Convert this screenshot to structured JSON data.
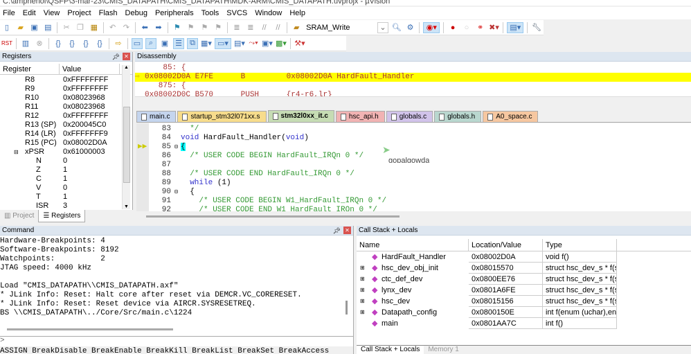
{
  "window": {
    "title": "C:\\amphenol\\QSFP\\3-mar-23\\CMIS_DATAPATH\\CMIS_DATAPATH\\MDK-ARM\\CMIS_DATAPATH.uvprojx - µVision"
  },
  "menu": [
    "File",
    "Edit",
    "View",
    "Project",
    "Flash",
    "Debug",
    "Peripherals",
    "Tools",
    "SVCS",
    "Window",
    "Help"
  ],
  "toolbar": {
    "target": "SRAM_Write"
  },
  "registers": {
    "title": "Registers",
    "col_register": "Register",
    "col_value": "Value",
    "rows": [
      {
        "name": "R8",
        "value": "0xFFFFFFFF"
      },
      {
        "name": "R9",
        "value": "0xFFFFFFFF"
      },
      {
        "name": "R10",
        "value": "0x08023968"
      },
      {
        "name": "R11",
        "value": "0x08023968"
      },
      {
        "name": "R12",
        "value": "0xFFFFFFFF"
      },
      {
        "name": "R13 (SP)",
        "value": "0x200045C0"
      },
      {
        "name": "R14 (LR)",
        "value": "0xFFFFFFF9"
      },
      {
        "name": "R15 (PC)",
        "value": "0x08002D0A"
      },
      {
        "name": "xPSR",
        "value": "0x61000003"
      },
      {
        "name": "N",
        "value": "0"
      },
      {
        "name": "Z",
        "value": "1"
      },
      {
        "name": "C",
        "value": "1"
      },
      {
        "name": "V",
        "value": "0"
      },
      {
        "name": "T",
        "value": "1"
      },
      {
        "name": "ISR",
        "value": "3"
      }
    ],
    "tabs": [
      "Project",
      "Registers"
    ]
  },
  "disassembly": {
    "title": "Disassembly",
    "lines": [
      {
        "text": "    85: {",
        "highlight": false
      },
      {
        "text": "0x08002D0A E7FE      B         0x08002D0A HardFault_Handler",
        "highlight": true
      },
      {
        "text": "   875: {",
        "highlight": false
      },
      {
        "text": "0x08002D0C B570      PUSH      {r4-r6,lr}",
        "highlight": false
      }
    ]
  },
  "editor": {
    "tabs": [
      {
        "label": "main.c",
        "color": "#c5d5ee"
      },
      {
        "label": "startup_stm32l071xx.s",
        "color": "#f7dc8c"
      },
      {
        "label": "stm32l0xx_it.c",
        "color": "#c6dcb4",
        "active": true
      },
      {
        "label": "hsc_api.h",
        "color": "#f1b3b3"
      },
      {
        "label": "globals.c",
        "color": "#d1c3ea"
      },
      {
        "label": "globals.h",
        "color": "#b9d7cf"
      },
      {
        "label": "A0_space.c",
        "color": "#f6c7a0"
      }
    ],
    "lines": [
      {
        "n": "83",
        "code": "  */",
        "cls": "cm"
      },
      {
        "n": "84",
        "code": "void HardFault_Handler(void)",
        "cls": ""
      },
      {
        "n": "85",
        "code": "{",
        "cls": ""
      },
      {
        "n": "86",
        "code": "  /* USER CODE BEGIN HardFault_IRQn 0 */",
        "cls": "cm"
      },
      {
        "n": "87",
        "code": "",
        "cls": ""
      },
      {
        "n": "88",
        "code": "  /* USER CODE END HardFault_IRQn 0 */",
        "cls": "cm"
      },
      {
        "n": "89",
        "code": "  while (1)",
        "cls": ""
      },
      {
        "n": "90",
        "code": "  {",
        "cls": ""
      },
      {
        "n": "91",
        "code": "    /* USER CODE BEGIN W1_HardFault_IRQn 0 */",
        "cls": "cm"
      },
      {
        "n": "92",
        "code": "    /* USER CODE END W1_HardFault_IRQn 0 */",
        "cls": "cm"
      }
    ],
    "tooltip": "gopalgowda"
  },
  "command": {
    "title": "Command",
    "lines": [
      "Hardware-Breakpoints: 4",
      "Software-Breakpoints: 8192",
      "Watchpoints:          2",
      "JTAG speed: 4000 kHz",
      "",
      "Load \"CMIS_DATAPATH\\\\CMIS_DATAPATH.axf\"",
      "* JLink Info: Reset: Halt core after reset via DEMCR.VC_CORERESET.",
      "* JLink Info: Reset: Reset device via AIRCR.SYSRESETREQ.",
      "BS \\\\CMIS_DATAPATH\\../Core/Src/main.c\\1224"
    ],
    "prompt": ">",
    "hints": "ASSIGN BreakDisable BreakEnable BreakKill BreakList BreakSet BreakAccess"
  },
  "callstack": {
    "title": "Call Stack + Locals",
    "col_name": "Name",
    "col_location": "Location/Value",
    "col_type": "Type",
    "rows": [
      {
        "name": "HardFault_Handler",
        "location": "0x08002D0A",
        "type": "void f()",
        "expand": false
      },
      {
        "name": "hsc_dev_obj_init",
        "location": "0x08015570",
        "type": "struct hsc_dev_s * f(str...",
        "expand": true
      },
      {
        "name": "ctc_def_dev",
        "location": "0x0800EE76",
        "type": "struct hsc_dev_s * f(str...",
        "expand": true
      },
      {
        "name": "lynx_dev",
        "location": "0x0801A6FE",
        "type": "struct hsc_dev_s * f(str...",
        "expand": true
      },
      {
        "name": "hsc_dev",
        "location": "0x08015156",
        "type": "struct hsc_dev_s * f(str...",
        "expand": true
      },
      {
        "name": "Datapath_config",
        "location": "0x0800150E",
        "type": "int f(enum (uchar),en...",
        "expand": true
      },
      {
        "name": "main",
        "location": "0x0801AA7C",
        "type": "int f()",
        "expand": false
      }
    ],
    "tabs": [
      "Call Stack + Locals",
      "Memory 1"
    ]
  }
}
